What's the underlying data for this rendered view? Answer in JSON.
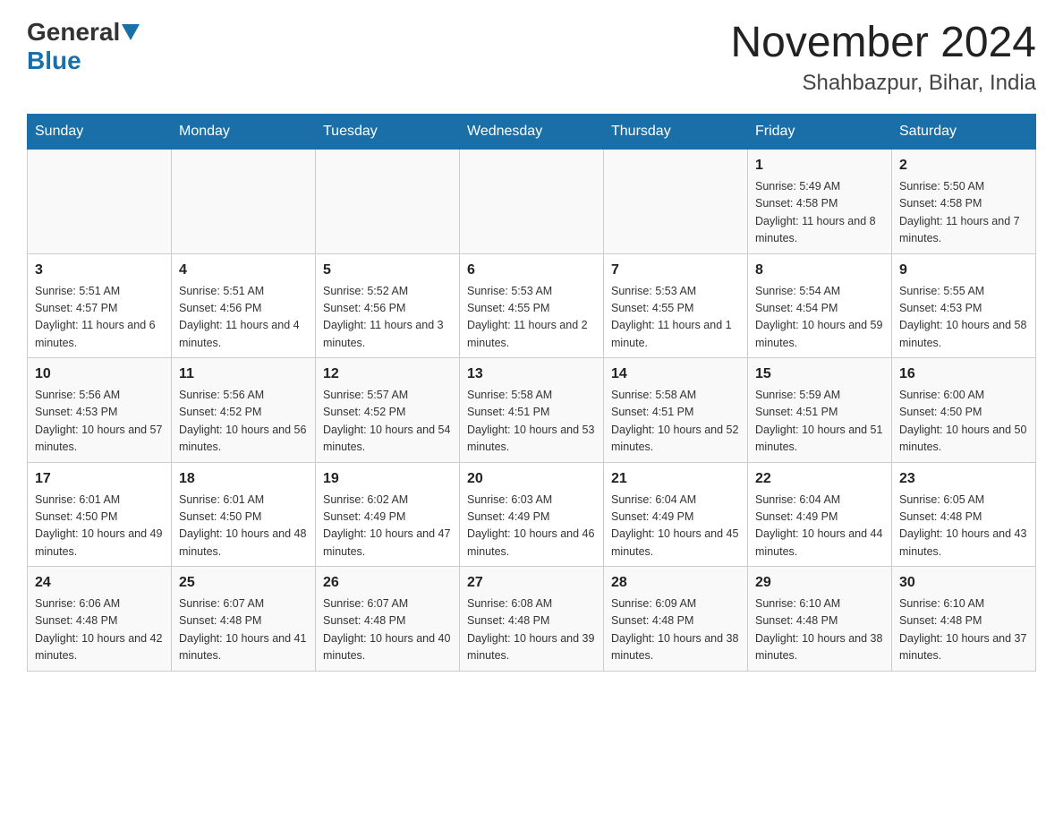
{
  "header": {
    "logo_general": "General",
    "logo_blue": "Blue",
    "month_title": "November 2024",
    "location": "Shahbazpur, Bihar, India"
  },
  "weekdays": [
    "Sunday",
    "Monday",
    "Tuesday",
    "Wednesday",
    "Thursday",
    "Friday",
    "Saturday"
  ],
  "weeks": [
    [
      {
        "day": "",
        "info": ""
      },
      {
        "day": "",
        "info": ""
      },
      {
        "day": "",
        "info": ""
      },
      {
        "day": "",
        "info": ""
      },
      {
        "day": "",
        "info": ""
      },
      {
        "day": "1",
        "info": "Sunrise: 5:49 AM\nSunset: 4:58 PM\nDaylight: 11 hours and 8 minutes."
      },
      {
        "day": "2",
        "info": "Sunrise: 5:50 AM\nSunset: 4:58 PM\nDaylight: 11 hours and 7 minutes."
      }
    ],
    [
      {
        "day": "3",
        "info": "Sunrise: 5:51 AM\nSunset: 4:57 PM\nDaylight: 11 hours and 6 minutes."
      },
      {
        "day": "4",
        "info": "Sunrise: 5:51 AM\nSunset: 4:56 PM\nDaylight: 11 hours and 4 minutes."
      },
      {
        "day": "5",
        "info": "Sunrise: 5:52 AM\nSunset: 4:56 PM\nDaylight: 11 hours and 3 minutes."
      },
      {
        "day": "6",
        "info": "Sunrise: 5:53 AM\nSunset: 4:55 PM\nDaylight: 11 hours and 2 minutes."
      },
      {
        "day": "7",
        "info": "Sunrise: 5:53 AM\nSunset: 4:55 PM\nDaylight: 11 hours and 1 minute."
      },
      {
        "day": "8",
        "info": "Sunrise: 5:54 AM\nSunset: 4:54 PM\nDaylight: 10 hours and 59 minutes."
      },
      {
        "day": "9",
        "info": "Sunrise: 5:55 AM\nSunset: 4:53 PM\nDaylight: 10 hours and 58 minutes."
      }
    ],
    [
      {
        "day": "10",
        "info": "Sunrise: 5:56 AM\nSunset: 4:53 PM\nDaylight: 10 hours and 57 minutes."
      },
      {
        "day": "11",
        "info": "Sunrise: 5:56 AM\nSunset: 4:52 PM\nDaylight: 10 hours and 56 minutes."
      },
      {
        "day": "12",
        "info": "Sunrise: 5:57 AM\nSunset: 4:52 PM\nDaylight: 10 hours and 54 minutes."
      },
      {
        "day": "13",
        "info": "Sunrise: 5:58 AM\nSunset: 4:51 PM\nDaylight: 10 hours and 53 minutes."
      },
      {
        "day": "14",
        "info": "Sunrise: 5:58 AM\nSunset: 4:51 PM\nDaylight: 10 hours and 52 minutes."
      },
      {
        "day": "15",
        "info": "Sunrise: 5:59 AM\nSunset: 4:51 PM\nDaylight: 10 hours and 51 minutes."
      },
      {
        "day": "16",
        "info": "Sunrise: 6:00 AM\nSunset: 4:50 PM\nDaylight: 10 hours and 50 minutes."
      }
    ],
    [
      {
        "day": "17",
        "info": "Sunrise: 6:01 AM\nSunset: 4:50 PM\nDaylight: 10 hours and 49 minutes."
      },
      {
        "day": "18",
        "info": "Sunrise: 6:01 AM\nSunset: 4:50 PM\nDaylight: 10 hours and 48 minutes."
      },
      {
        "day": "19",
        "info": "Sunrise: 6:02 AM\nSunset: 4:49 PM\nDaylight: 10 hours and 47 minutes."
      },
      {
        "day": "20",
        "info": "Sunrise: 6:03 AM\nSunset: 4:49 PM\nDaylight: 10 hours and 46 minutes."
      },
      {
        "day": "21",
        "info": "Sunrise: 6:04 AM\nSunset: 4:49 PM\nDaylight: 10 hours and 45 minutes."
      },
      {
        "day": "22",
        "info": "Sunrise: 6:04 AM\nSunset: 4:49 PM\nDaylight: 10 hours and 44 minutes."
      },
      {
        "day": "23",
        "info": "Sunrise: 6:05 AM\nSunset: 4:48 PM\nDaylight: 10 hours and 43 minutes."
      }
    ],
    [
      {
        "day": "24",
        "info": "Sunrise: 6:06 AM\nSunset: 4:48 PM\nDaylight: 10 hours and 42 minutes."
      },
      {
        "day": "25",
        "info": "Sunrise: 6:07 AM\nSunset: 4:48 PM\nDaylight: 10 hours and 41 minutes."
      },
      {
        "day": "26",
        "info": "Sunrise: 6:07 AM\nSunset: 4:48 PM\nDaylight: 10 hours and 40 minutes."
      },
      {
        "day": "27",
        "info": "Sunrise: 6:08 AM\nSunset: 4:48 PM\nDaylight: 10 hours and 39 minutes."
      },
      {
        "day": "28",
        "info": "Sunrise: 6:09 AM\nSunset: 4:48 PM\nDaylight: 10 hours and 38 minutes."
      },
      {
        "day": "29",
        "info": "Sunrise: 6:10 AM\nSunset: 4:48 PM\nDaylight: 10 hours and 38 minutes."
      },
      {
        "day": "30",
        "info": "Sunrise: 6:10 AM\nSunset: 4:48 PM\nDaylight: 10 hours and 37 minutes."
      }
    ]
  ]
}
